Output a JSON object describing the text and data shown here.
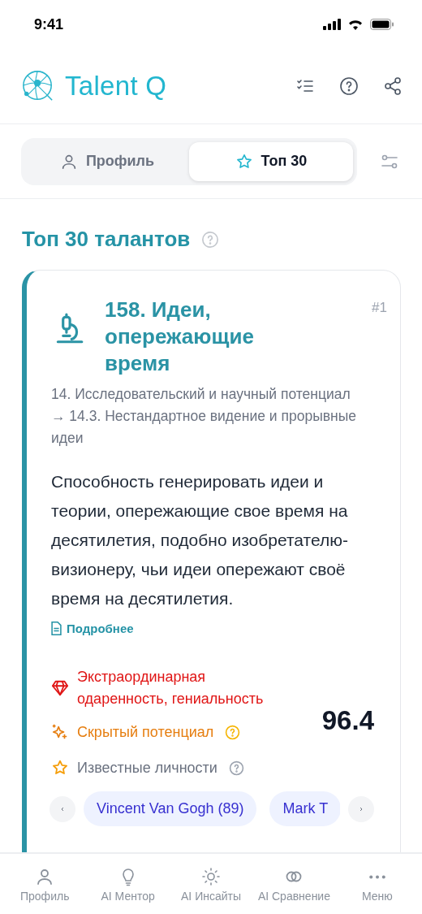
{
  "status_bar": {
    "time": "9:41"
  },
  "header": {
    "brand": "Talent Q"
  },
  "tabs": [
    {
      "label": "Профиль",
      "kind": "person",
      "selected": false
    },
    {
      "label": "Топ 30",
      "kind": "star",
      "selected": true
    }
  ],
  "page_title": "Топ 30 талантов",
  "card": {
    "title": "158. Идеи, опережающие время",
    "rank": "#1",
    "path": "14. Исследовательский и научный потенциал → 14.3. Нестандартное видение и прорывные идеи",
    "description": "Способность генерировать идеи и теории, опережающие свое время на десятилетия, подобно изобретателю-визионеру, чьи идеи опережают своё время на десятилетия.",
    "more_link": "Подробнее",
    "level_label": "Экстраординарная одаренность, гениальность",
    "potential_label": "Скрытый потенциал",
    "score": "96.4",
    "people_label": "Известные личности",
    "people": [
      "Vincent Van Gogh (89)",
      "Mark T"
    ]
  },
  "bottom_nav": [
    {
      "label": "Профиль",
      "kind": "person",
      "selected": false
    },
    {
      "label": "AI Ментор",
      "kind": "bulb",
      "selected": false
    },
    {
      "label": "AI Инсайты",
      "kind": "sun",
      "selected": false
    },
    {
      "label": "AI Сравнение",
      "kind": "rings",
      "selected": false
    },
    {
      "label": "Меню",
      "kind": "dots",
      "selected": false
    }
  ]
}
